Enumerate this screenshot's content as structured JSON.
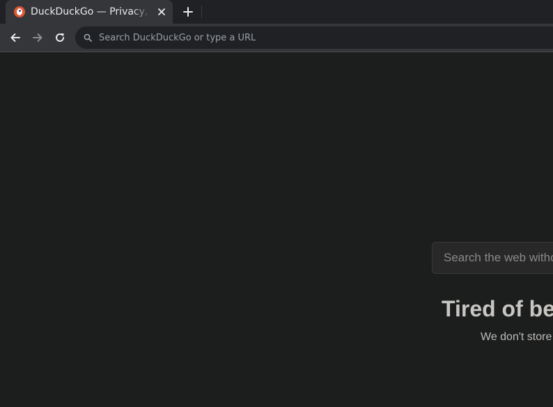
{
  "browser": {
    "tab": {
      "title": "DuckDuckGo — Privacy, simplified."
    },
    "omnibox": {
      "placeholder": "Search DuckDuckGo or type a URL"
    }
  },
  "page": {
    "search_placeholder": "Search the web without being tracked",
    "heading": "Tired of being tracked online?",
    "subtext": "We don't store your personal info."
  },
  "colors": {
    "background": "#1c1d1d",
    "tabstrip": "#202124",
    "toolbar": "#35363a",
    "brand": "#de5833"
  }
}
